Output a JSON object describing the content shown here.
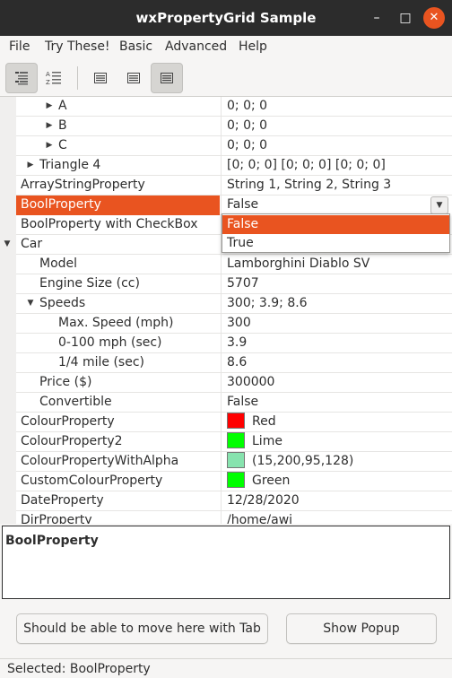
{
  "window": {
    "title": "wxPropertyGrid Sample",
    "minimize": "–",
    "maximize": "□",
    "close": "✕"
  },
  "menu": [
    "File",
    "Try These!",
    "Basic",
    "Advanced",
    "Help"
  ],
  "toolbar": {
    "buttons": [
      "categorized-view",
      "alphabetic-view",
      "page-1",
      "page-2",
      "page-3"
    ]
  },
  "grid": {
    "rows": [
      {
        "name": "A",
        "value": "0; 0; 0",
        "indent": 2,
        "expander": "collapsed"
      },
      {
        "name": "B",
        "value": "0; 0; 0",
        "indent": 2,
        "expander": "collapsed"
      },
      {
        "name": "C",
        "value": "0; 0; 0",
        "indent": 2,
        "expander": "collapsed"
      },
      {
        "name": "Triangle 4",
        "value": "[0; 0; 0] [0; 0; 0] [0; 0; 0]",
        "indent": 1,
        "expander": "collapsed"
      },
      {
        "name": "ArrayStringProperty",
        "value": "String 1, String 2, String 3",
        "indent": 0
      },
      {
        "name": "BoolProperty",
        "value": "False",
        "indent": 0,
        "selected": true
      },
      {
        "name": "BoolProperty with CheckBox",
        "value": "",
        "indent": 0
      },
      {
        "name": "Car",
        "value": "",
        "indent": 0,
        "category": true,
        "expander": "expanded"
      },
      {
        "name": "Model",
        "value": "Lamborghini Diablo SV",
        "indent": 1
      },
      {
        "name": "Engine Size (cc)",
        "value": "5707",
        "indent": 1
      },
      {
        "name": "Speeds",
        "value": "300; 3.9; 8.6",
        "indent": 1,
        "expander": "expanded"
      },
      {
        "name": "Max. Speed (mph)",
        "value": "300",
        "indent": 2
      },
      {
        "name": "0-100 mph (sec)",
        "value": "3.9",
        "indent": 2
      },
      {
        "name": "1/4 mile (sec)",
        "value": "8.6",
        "indent": 2
      },
      {
        "name": "Price ($)",
        "value": "300000",
        "indent": 1
      },
      {
        "name": "Convertible",
        "value": "False",
        "indent": 1
      },
      {
        "name": "ColourProperty",
        "value": "Red",
        "indent": 0,
        "swatch": "#ff0000"
      },
      {
        "name": "ColourProperty2",
        "value": "Lime",
        "indent": 0,
        "swatch": "#00ff00"
      },
      {
        "name": "ColourPropertyWithAlpha",
        "value": "(15,200,95,128)",
        "indent": 0,
        "swatch": "#87e3ae"
      },
      {
        "name": "CustomColourProperty",
        "value": "Green",
        "indent": 0,
        "swatch": "#00ff00"
      },
      {
        "name": "DateProperty",
        "value": "12/28/2020",
        "indent": 0
      },
      {
        "name": "DirProperty",
        "value": "/home/awi",
        "indent": 0
      }
    ]
  },
  "dropdown": {
    "options": [
      "False",
      "True"
    ],
    "highlighted": 0
  },
  "description": {
    "title": "BoolProperty",
    "body": ""
  },
  "buttons": {
    "tab_button": "Should be able to move here with Tab",
    "popup_button": "Show Popup"
  },
  "status": "Selected: BoolProperty",
  "colors": {
    "accent": "#e95420",
    "titlebar": "#2c2c2c"
  }
}
